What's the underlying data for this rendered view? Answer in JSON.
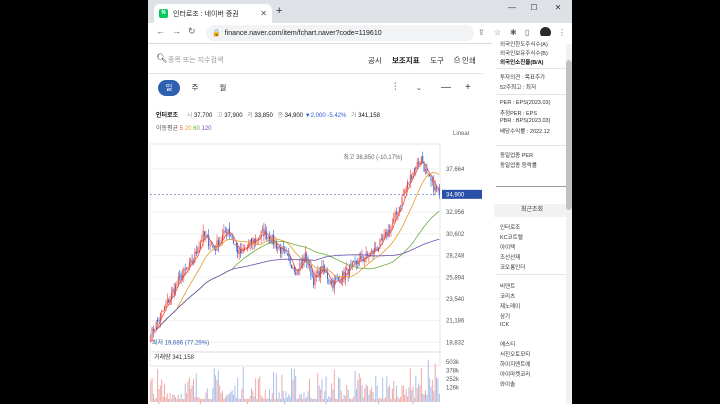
{
  "browser": {
    "tab_title": "인터로조 : 네이버 증권",
    "tab_favicon": "N",
    "url": "finance.naver.com/item/fchart.naver?code=119610"
  },
  "topbar": {
    "search_placeholder": "종목 또는 지수검색",
    "menu": [
      "공시",
      "보조지표",
      "도구",
      "인쇄"
    ]
  },
  "period_tabs": [
    "일",
    "주",
    "월"
  ],
  "stock": {
    "name": "인터로조",
    "labels": {
      "open": "시",
      "high": "고",
      "low": "저",
      "close": "종",
      "vol": "거"
    },
    "open": "37,700",
    "high": "37,900",
    "low": "33,850",
    "close": "34,900",
    "change": "▼2,000",
    "change_pct": "-5.42%",
    "volume": "341,158"
  },
  "ma": {
    "label": "이동평균",
    "periods": [
      "5",
      "20",
      "60",
      "120"
    ]
  },
  "scale_mode": "Linear",
  "colors": {
    "up": "#e8413a",
    "down": "#2a5ed6",
    "ma5": "#e8513d",
    "ma20": "#e39b2a",
    "ma60": "#6dad3c",
    "ma120": "#6b4fb0",
    "current_tag": "#2a4fa8"
  },
  "chart_data": {
    "type": "candlestick",
    "y_ticks": [
      "37,664",
      "34,900",
      "32,956",
      "30,602",
      "28,248",
      "25,894",
      "23,540",
      "21,186",
      "18,832"
    ],
    "ylim": [
      18100,
      39500
    ],
    "current_price": "34,900",
    "high_annotation": "최고 38,850 (-10.17%)",
    "low_annotation": "최저 19,686 (77.29%)",
    "high_value": 38850,
    "low_value": 19686,
    "x_ticks": [
      "4월",
      "8월",
      "2022",
      "4월",
      "8월",
      "2023",
      "4월"
    ],
    "trend_anchors": [
      [
        0,
        19700
      ],
      [
        10,
        22500
      ],
      [
        20,
        25500
      ],
      [
        30,
        27500
      ],
      [
        38,
        30500
      ],
      [
        46,
        29000
      ],
      [
        56,
        31200
      ],
      [
        64,
        28400
      ],
      [
        72,
        29500
      ],
      [
        82,
        30800
      ],
      [
        90,
        29600
      ],
      [
        100,
        27800
      ],
      [
        106,
        26600
      ],
      [
        112,
        28200
      ],
      [
        118,
        25600
      ],
      [
        124,
        26800
      ],
      [
        132,
        25200
      ],
      [
        140,
        26200
      ],
      [
        150,
        27600
      ],
      [
        160,
        28500
      ],
      [
        168,
        29800
      ],
      [
        176,
        32000
      ],
      [
        184,
        35200
      ],
      [
        190,
        37500
      ],
      [
        196,
        38850
      ],
      [
        200,
        36800
      ],
      [
        204,
        36000
      ],
      [
        206,
        35500
      ],
      [
        210,
        34900
      ]
    ],
    "volume": {
      "label": "거래량",
      "value": "341,158",
      "y_ticks": [
        "503k",
        "378k",
        "252k",
        "126k"
      ]
    }
  },
  "side_panel": {
    "top_lines": [
      "외국인한도주식수(A)",
      "외국인보유주식수(B)",
      "외국인소진율(B/A)"
    ],
    "invest_lines": [
      "투자의견 : 목표주가",
      "52주최고 : 최저"
    ],
    "per_lines": [
      "PER : EPS(2023.03)",
      "추정PER : EPS",
      "PBR : BPS(2023.03)",
      "배당수익률 : 2022.12"
    ],
    "sector_lines": [
      "동일업종 PER",
      "동일업종 등락률"
    ],
    "recent_header": "최근조회",
    "recent_items": [
      "인터로조",
      "KC코트렐",
      "아이텍",
      "조선선재",
      "코오롱인더"
    ],
    "more_items": [
      "비덴트",
      "코리츠",
      "제노레이",
      "삼기",
      "ICK",
      "에스티",
      "서진오토모티",
      "하이지엔트에",
      "아이마켓코리",
      "와이솔"
    ]
  }
}
